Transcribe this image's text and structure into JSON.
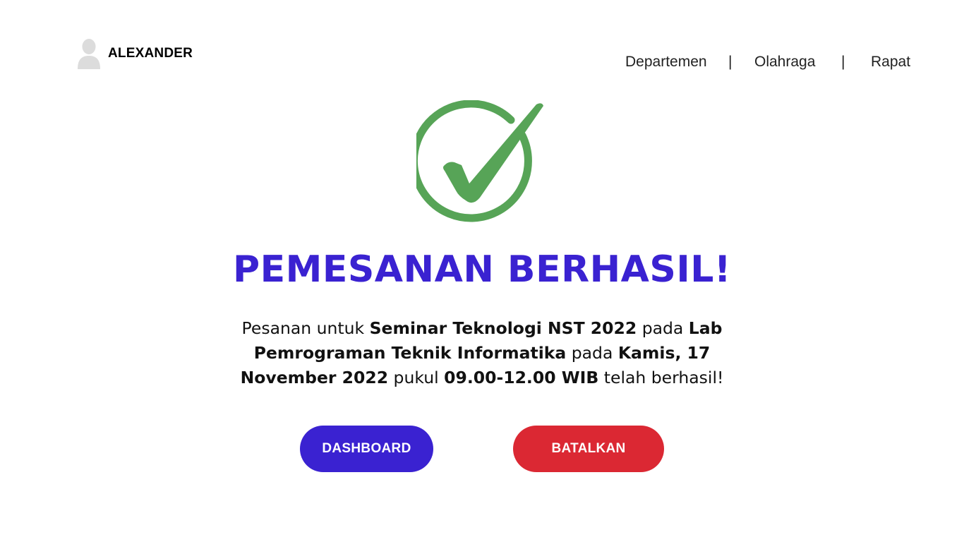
{
  "user": {
    "name": "ALEXANDER",
    "avatar_icon": "user-avatar-icon"
  },
  "nav": {
    "items": [
      "Departemen",
      "Olahraga",
      "Rapat"
    ],
    "separator": "|"
  },
  "status_icon": "check-circle-icon",
  "colors": {
    "primary": "#3a22d1",
    "danger": "#db2833",
    "success": "#57a457"
  },
  "title": "PEMESANAN BERHASIL!",
  "message": {
    "t1": "Pesanan untuk ",
    "event": "Seminar Teknologi NST 2022",
    "t2": " pada ",
    "location": "Lab Pemrograman Teknik Informatika",
    "t3": " pada ",
    "date": "Kamis, 17 November 2022",
    "t4": " pukul ",
    "time": "09.00-12.00 WIB",
    "t5": " telah berhasil!"
  },
  "buttons": {
    "dashboard": "DASHBOARD",
    "cancel": "BATALKAN"
  }
}
